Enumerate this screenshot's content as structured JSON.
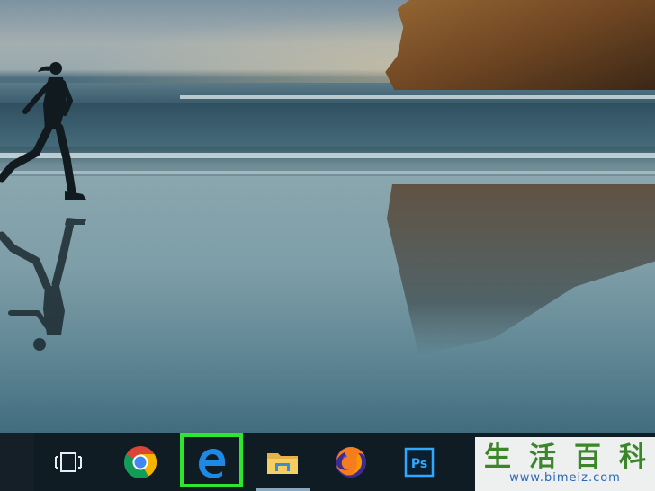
{
  "taskbar": {
    "items": [
      {
        "id": "task-view",
        "icon": "task-view-icon"
      },
      {
        "id": "chrome",
        "icon": "chrome-icon"
      },
      {
        "id": "edge",
        "icon": "edge-icon",
        "highlighted": true
      },
      {
        "id": "file-explorer",
        "icon": "folder-icon"
      },
      {
        "id": "firefox",
        "icon": "firefox-icon"
      },
      {
        "id": "photoshop",
        "icon": "photoshop-icon",
        "label": "Ps"
      }
    ],
    "highlight_color": "#2ee62e"
  },
  "watermark": {
    "chars": [
      "生",
      "活",
      "百",
      "科"
    ],
    "url": "www.bimeiz.com"
  }
}
